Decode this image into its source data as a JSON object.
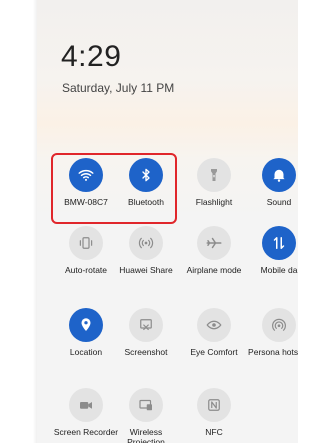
{
  "clock": {
    "time": "4:29",
    "date": "Saturday, July 11  PM"
  },
  "tiles": [
    {
      "label": "BMW-08C7",
      "on": true
    },
    {
      "label": "Bluetooth",
      "on": true
    },
    {
      "label": "Flashlight",
      "on": false
    },
    {
      "label": "Sound",
      "on": true
    },
    {
      "label": "Auto-rotate",
      "on": false
    },
    {
      "label": "Huawei Share",
      "on": false
    },
    {
      "label": "Airplane mode",
      "on": false
    },
    {
      "label": "Mobile da",
      "on": true
    },
    {
      "label": "Location",
      "on": true
    },
    {
      "label": "Screenshot",
      "on": false
    },
    {
      "label": "Eye Comfort",
      "on": false
    },
    {
      "label": "Persona hotspot",
      "on": false
    },
    {
      "label": "Screen Recorder",
      "on": false
    },
    {
      "label": "Wireless Projection",
      "on": false
    },
    {
      "label": "NFC",
      "on": false
    }
  ],
  "colors": {
    "accent": "#1e63c9",
    "highlight": "#e0262b",
    "tile_off": "#e3e3e3"
  }
}
